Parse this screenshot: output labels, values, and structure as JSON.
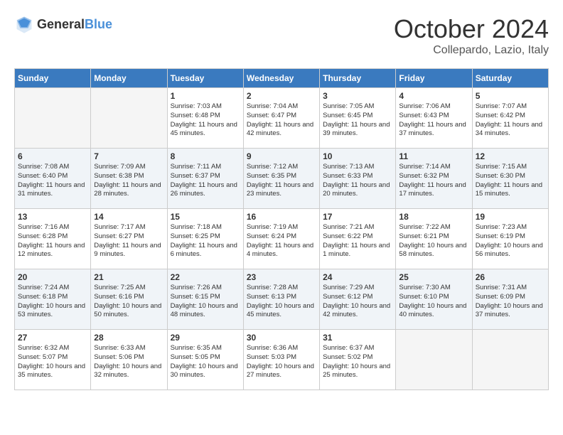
{
  "header": {
    "logo_general": "General",
    "logo_blue": "Blue",
    "month": "October 2024",
    "location": "Collepardo, Lazio, Italy"
  },
  "days_of_week": [
    "Sunday",
    "Monday",
    "Tuesday",
    "Wednesday",
    "Thursday",
    "Friday",
    "Saturday"
  ],
  "weeks": [
    [
      {
        "day": "",
        "empty": true
      },
      {
        "day": "",
        "empty": true
      },
      {
        "day": "1",
        "sunrise": "Sunrise: 7:03 AM",
        "sunset": "Sunset: 6:48 PM",
        "daylight": "Daylight: 11 hours and 45 minutes."
      },
      {
        "day": "2",
        "sunrise": "Sunrise: 7:04 AM",
        "sunset": "Sunset: 6:47 PM",
        "daylight": "Daylight: 11 hours and 42 minutes."
      },
      {
        "day": "3",
        "sunrise": "Sunrise: 7:05 AM",
        "sunset": "Sunset: 6:45 PM",
        "daylight": "Daylight: 11 hours and 39 minutes."
      },
      {
        "day": "4",
        "sunrise": "Sunrise: 7:06 AM",
        "sunset": "Sunset: 6:43 PM",
        "daylight": "Daylight: 11 hours and 37 minutes."
      },
      {
        "day": "5",
        "sunrise": "Sunrise: 7:07 AM",
        "sunset": "Sunset: 6:42 PM",
        "daylight": "Daylight: 11 hours and 34 minutes."
      }
    ],
    [
      {
        "day": "6",
        "sunrise": "Sunrise: 7:08 AM",
        "sunset": "Sunset: 6:40 PM",
        "daylight": "Daylight: 11 hours and 31 minutes."
      },
      {
        "day": "7",
        "sunrise": "Sunrise: 7:09 AM",
        "sunset": "Sunset: 6:38 PM",
        "daylight": "Daylight: 11 hours and 28 minutes."
      },
      {
        "day": "8",
        "sunrise": "Sunrise: 7:11 AM",
        "sunset": "Sunset: 6:37 PM",
        "daylight": "Daylight: 11 hours and 26 minutes."
      },
      {
        "day": "9",
        "sunrise": "Sunrise: 7:12 AM",
        "sunset": "Sunset: 6:35 PM",
        "daylight": "Daylight: 11 hours and 23 minutes."
      },
      {
        "day": "10",
        "sunrise": "Sunrise: 7:13 AM",
        "sunset": "Sunset: 6:33 PM",
        "daylight": "Daylight: 11 hours and 20 minutes."
      },
      {
        "day": "11",
        "sunrise": "Sunrise: 7:14 AM",
        "sunset": "Sunset: 6:32 PM",
        "daylight": "Daylight: 11 hours and 17 minutes."
      },
      {
        "day": "12",
        "sunrise": "Sunrise: 7:15 AM",
        "sunset": "Sunset: 6:30 PM",
        "daylight": "Daylight: 11 hours and 15 minutes."
      }
    ],
    [
      {
        "day": "13",
        "sunrise": "Sunrise: 7:16 AM",
        "sunset": "Sunset: 6:28 PM",
        "daylight": "Daylight: 11 hours and 12 minutes."
      },
      {
        "day": "14",
        "sunrise": "Sunrise: 7:17 AM",
        "sunset": "Sunset: 6:27 PM",
        "daylight": "Daylight: 11 hours and 9 minutes."
      },
      {
        "day": "15",
        "sunrise": "Sunrise: 7:18 AM",
        "sunset": "Sunset: 6:25 PM",
        "daylight": "Daylight: 11 hours and 6 minutes."
      },
      {
        "day": "16",
        "sunrise": "Sunrise: 7:19 AM",
        "sunset": "Sunset: 6:24 PM",
        "daylight": "Daylight: 11 hours and 4 minutes."
      },
      {
        "day": "17",
        "sunrise": "Sunrise: 7:21 AM",
        "sunset": "Sunset: 6:22 PM",
        "daylight": "Daylight: 11 hours and 1 minute."
      },
      {
        "day": "18",
        "sunrise": "Sunrise: 7:22 AM",
        "sunset": "Sunset: 6:21 PM",
        "daylight": "Daylight: 10 hours and 58 minutes."
      },
      {
        "day": "19",
        "sunrise": "Sunrise: 7:23 AM",
        "sunset": "Sunset: 6:19 PM",
        "daylight": "Daylight: 10 hours and 56 minutes."
      }
    ],
    [
      {
        "day": "20",
        "sunrise": "Sunrise: 7:24 AM",
        "sunset": "Sunset: 6:18 PM",
        "daylight": "Daylight: 10 hours and 53 minutes."
      },
      {
        "day": "21",
        "sunrise": "Sunrise: 7:25 AM",
        "sunset": "Sunset: 6:16 PM",
        "daylight": "Daylight: 10 hours and 50 minutes."
      },
      {
        "day": "22",
        "sunrise": "Sunrise: 7:26 AM",
        "sunset": "Sunset: 6:15 PM",
        "daylight": "Daylight: 10 hours and 48 minutes."
      },
      {
        "day": "23",
        "sunrise": "Sunrise: 7:28 AM",
        "sunset": "Sunset: 6:13 PM",
        "daylight": "Daylight: 10 hours and 45 minutes."
      },
      {
        "day": "24",
        "sunrise": "Sunrise: 7:29 AM",
        "sunset": "Sunset: 6:12 PM",
        "daylight": "Daylight: 10 hours and 42 minutes."
      },
      {
        "day": "25",
        "sunrise": "Sunrise: 7:30 AM",
        "sunset": "Sunset: 6:10 PM",
        "daylight": "Daylight: 10 hours and 40 minutes."
      },
      {
        "day": "26",
        "sunrise": "Sunrise: 7:31 AM",
        "sunset": "Sunset: 6:09 PM",
        "daylight": "Daylight: 10 hours and 37 minutes."
      }
    ],
    [
      {
        "day": "27",
        "sunrise": "Sunrise: 6:32 AM",
        "sunset": "Sunset: 5:07 PM",
        "daylight": "Daylight: 10 hours and 35 minutes."
      },
      {
        "day": "28",
        "sunrise": "Sunrise: 6:33 AM",
        "sunset": "Sunset: 5:06 PM",
        "daylight": "Daylight: 10 hours and 32 minutes."
      },
      {
        "day": "29",
        "sunrise": "Sunrise: 6:35 AM",
        "sunset": "Sunset: 5:05 PM",
        "daylight": "Daylight: 10 hours and 30 minutes."
      },
      {
        "day": "30",
        "sunrise": "Sunrise: 6:36 AM",
        "sunset": "Sunset: 5:03 PM",
        "daylight": "Daylight: 10 hours and 27 minutes."
      },
      {
        "day": "31",
        "sunrise": "Sunrise: 6:37 AM",
        "sunset": "Sunset: 5:02 PM",
        "daylight": "Daylight: 10 hours and 25 minutes."
      },
      {
        "day": "",
        "empty": true
      },
      {
        "day": "",
        "empty": true
      }
    ]
  ]
}
